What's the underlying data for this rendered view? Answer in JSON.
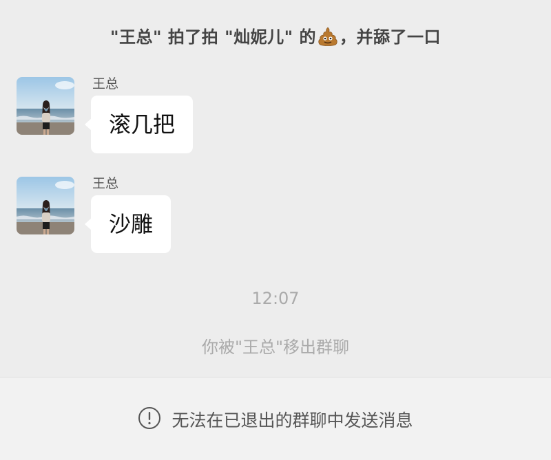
{
  "pat_notice": {
    "actor": "\"王总\"",
    "verb": "拍了拍",
    "target": "\"灿妮儿\"",
    "possessive": "的",
    "icon": "poop-emoji-icon",
    "suffix": "，并舔了一口"
  },
  "messages": [
    {
      "sender": "王总",
      "text": "滚几把"
    },
    {
      "sender": "王总",
      "text": "沙雕"
    }
  ],
  "timestamp": "12:07",
  "system_message": "你被\"王总\"移出群聊",
  "bottom_bar": {
    "icon": "info-circle-icon",
    "text": "无法在已退出的群聊中发送消息"
  },
  "colors": {
    "background": "#ededed",
    "bubble": "#ffffff",
    "system_text": "#aaaaaa"
  }
}
